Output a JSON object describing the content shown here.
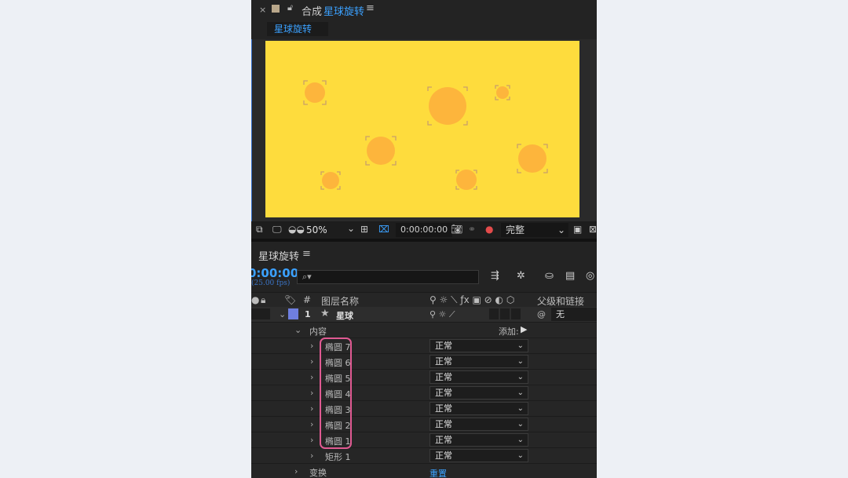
{
  "composition": {
    "close_glyph": "×",
    "panel_label": "合成",
    "name": "星球旋转",
    "menu_glyph": "≡",
    "tab_label": "星球旋转"
  },
  "viewer": {
    "background_color": "#fedc3d",
    "circle_color": "#fdb53c",
    "zoom": "50%",
    "timecode": "0:00:00:00",
    "resolution": "完整"
  },
  "timeline": {
    "title": "星球旋转",
    "menu_glyph": "≡",
    "timecode": "0:00:00",
    "fps": "(25.00 fps)",
    "search_placeholder": "⌕▾",
    "columns": {
      "num": "#",
      "layer_name": "图层名称",
      "parent": "父级和链接"
    },
    "layer": {
      "index": "1",
      "name": "星球",
      "parent_value": "无"
    },
    "contents_label": "内容",
    "add_label": "添加:",
    "shapes": [
      {
        "name": "椭圆 7",
        "mode": "正常"
      },
      {
        "name": "椭圆 6",
        "mode": "正常"
      },
      {
        "name": "椭圆 5",
        "mode": "正常"
      },
      {
        "name": "椭圆 4",
        "mode": "正常"
      },
      {
        "name": "椭圆 3",
        "mode": "正常"
      },
      {
        "name": "椭圆 2",
        "mode": "正常"
      },
      {
        "name": "椭圆 1",
        "mode": "正常"
      },
      {
        "name": "矩形 1",
        "mode": "正常"
      }
    ],
    "transform_label": "变换",
    "reset_label": "重置"
  }
}
